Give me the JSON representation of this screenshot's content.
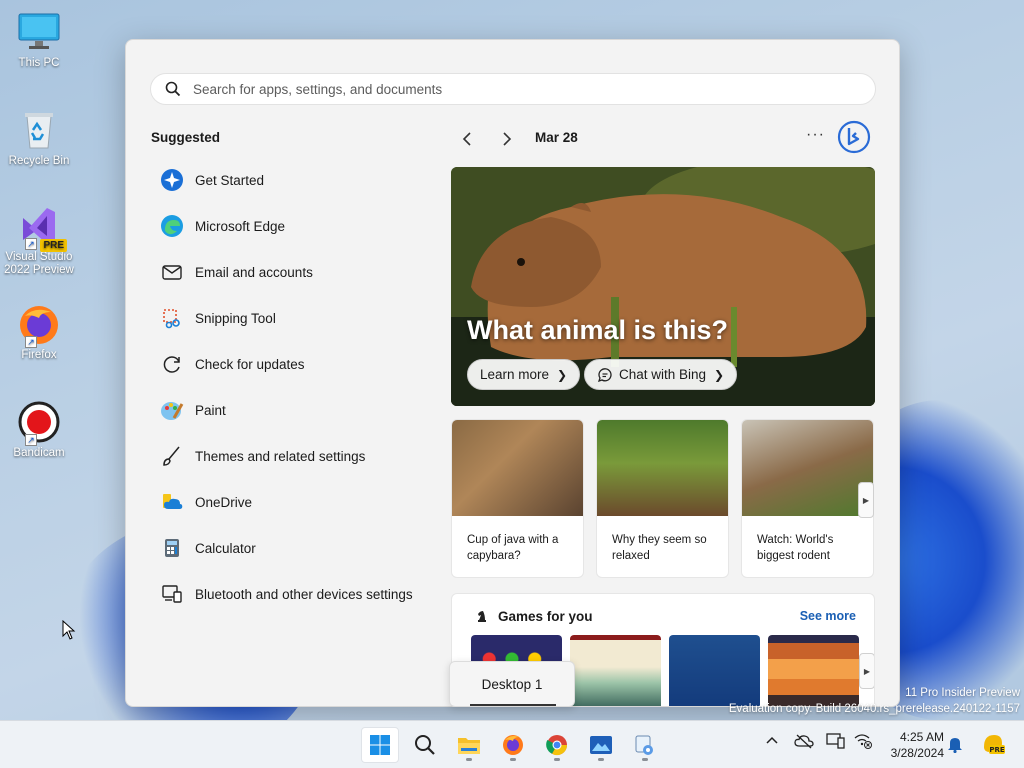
{
  "desktop": {
    "icons": [
      {
        "label": "This PC"
      },
      {
        "label": "Recycle Bin"
      },
      {
        "label": "Visual Studio 2022 Preview",
        "badge": "PRE"
      },
      {
        "label": "Firefox"
      },
      {
        "label": "Bandicam"
      }
    ],
    "watermark": {
      "line1": "11 Pro Insider Preview",
      "line2": "Evaluation copy. Build 26040.rs_prerelease.240122-1157"
    }
  },
  "start": {
    "search_placeholder": "Search for apps, settings, and documents",
    "suggested_title": "Suggested",
    "suggested": [
      {
        "label": "Get Started",
        "icon": "get-started-icon"
      },
      {
        "label": "Microsoft Edge",
        "icon": "edge-icon"
      },
      {
        "label": "Email and accounts",
        "icon": "mail-icon"
      },
      {
        "label": "Snipping Tool",
        "icon": "snipping-tool-icon"
      },
      {
        "label": "Check for updates",
        "icon": "update-icon"
      },
      {
        "label": "Paint",
        "icon": "paint-icon"
      },
      {
        "label": "Themes and related settings",
        "icon": "brush-icon"
      },
      {
        "label": "OneDrive",
        "icon": "onedrive-icon"
      },
      {
        "label": "Calculator",
        "icon": "calculator-icon"
      },
      {
        "label": "Bluetooth and other devices settings",
        "icon": "devices-icon"
      }
    ],
    "date": "Mar 28",
    "hero": {
      "title": "What animal is this?",
      "learn_more": "Learn more",
      "chat": "Chat with Bing"
    },
    "cards": [
      {
        "caption": "Cup of java with a capybara?"
      },
      {
        "caption": "Why they seem so relaxed"
      },
      {
        "caption": "Watch: World's biggest rodent"
      }
    ],
    "games": {
      "title": "Games for you",
      "see_more": "See more"
    },
    "desktop_tooltip": "Desktop 1"
  },
  "taskbar": {
    "apps": [
      "start-icon",
      "search-icon",
      "file-explorer-icon",
      "firefox-icon",
      "chrome-icon",
      "photos-icon",
      "snipping-icon"
    ],
    "time": "4:25 AM",
    "date": "3/28/2024"
  }
}
